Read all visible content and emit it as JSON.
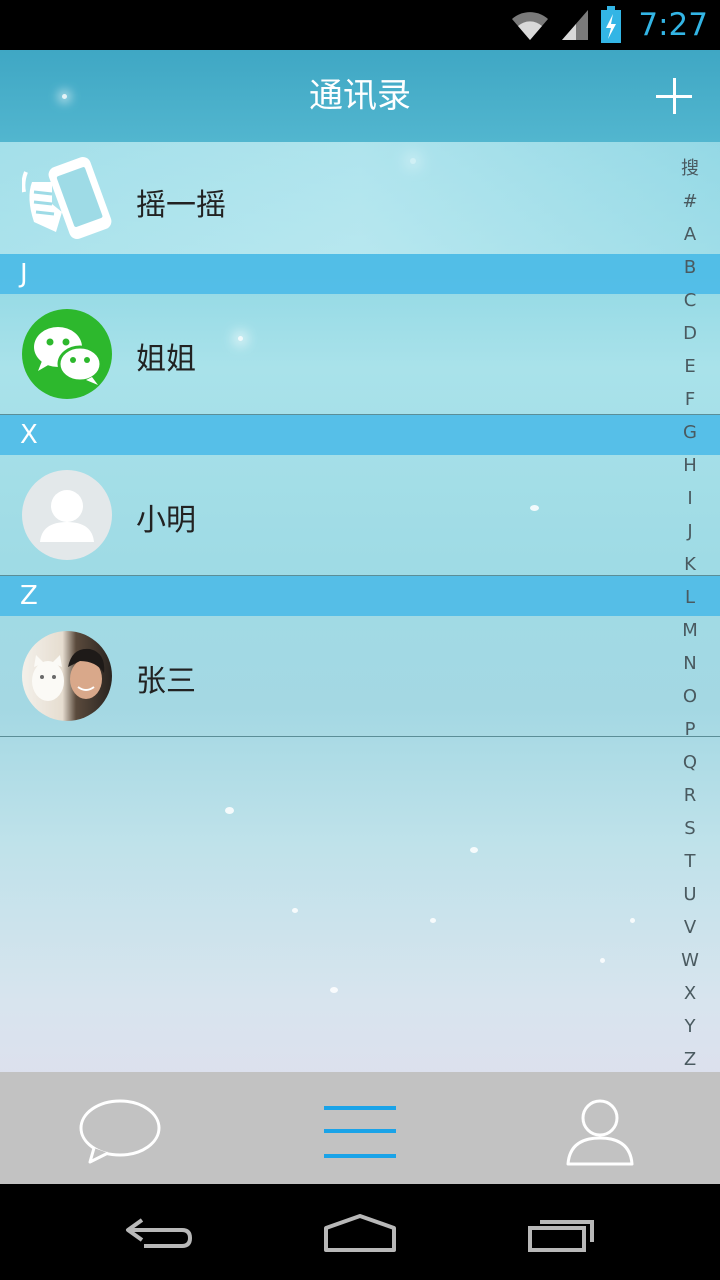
{
  "status_bar": {
    "time": "7:27",
    "icons": [
      "wifi-icon",
      "signal-icon",
      "battery-charging-icon"
    ],
    "time_color": "#33b5e5"
  },
  "header": {
    "title": "通讯录",
    "add_icon": "plus-icon"
  },
  "shake": {
    "label": "摇一摇",
    "icon": "shake-phone-icon"
  },
  "sections": [
    {
      "letter": "J",
      "contacts": [
        {
          "name": "姐姐",
          "avatar": "wechat-avatar"
        }
      ]
    },
    {
      "letter": "X",
      "contacts": [
        {
          "name": "小明",
          "avatar": "default-person-avatar"
        }
      ]
    },
    {
      "letter": "Z",
      "contacts": [
        {
          "name": "张三",
          "avatar": "photo-avatar"
        }
      ]
    }
  ],
  "index_bar": [
    "搜",
    "#",
    "A",
    "B",
    "C",
    "D",
    "E",
    "F",
    "G",
    "H",
    "I",
    "J",
    "K",
    "L",
    "M",
    "N",
    "O",
    "P",
    "Q",
    "R",
    "S",
    "T",
    "U",
    "V",
    "W",
    "X",
    "Y",
    "Z"
  ],
  "bottom_tabs": [
    {
      "icon": "chat-bubble-icon",
      "selected": false
    },
    {
      "icon": "contacts-list-icon",
      "selected": true
    },
    {
      "icon": "profile-icon",
      "selected": false
    }
  ],
  "nav_bar": [
    "back-icon",
    "home-icon",
    "recent-apps-icon"
  ],
  "colors": {
    "accent": "#33b5e5",
    "section_header": "#40b6e8",
    "bottom_bar": "#c2c2c2"
  }
}
